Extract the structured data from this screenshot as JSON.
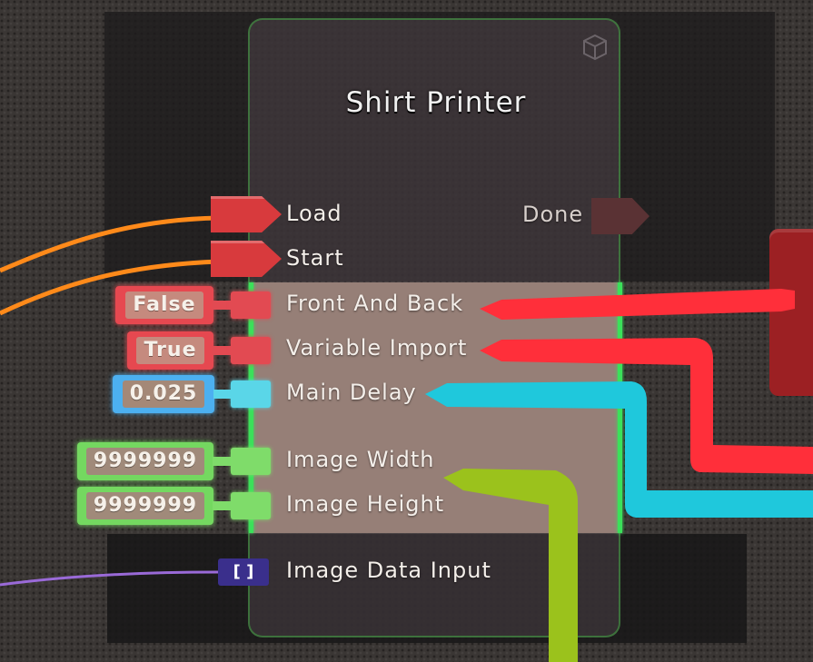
{
  "node": {
    "title": "Shirt Printer",
    "icon": "cube-icon",
    "impulse_inputs": [
      {
        "label": "Load"
      },
      {
        "label": "Start"
      }
    ],
    "impulse_outputs": [
      {
        "label": "Done"
      }
    ],
    "value_inputs": [
      {
        "label": "Front And Back",
        "value": "False",
        "type_color": "#e24a52"
      },
      {
        "label": "Variable Import",
        "value": "True",
        "type_color": "#e24a52"
      },
      {
        "label": "Main Delay",
        "value": "0.025",
        "type_color": "#5ad6e8"
      },
      {
        "label": "Image Width",
        "value": "9999999",
        "type_color": "#7fdc6a"
      },
      {
        "label": "Image Height",
        "value": "9999999",
        "type_color": "#7fdc6a"
      }
    ],
    "data_input": {
      "label": "Image Data Input",
      "pin_symbol": "[ ]"
    }
  },
  "colors": {
    "bool_wire": "#ff2f3a",
    "float_wire": "#1fc8dc",
    "int_wire": "#9bc21c",
    "impulse_wire": "#ff8a1a",
    "data_wire": "#9a6ad8",
    "node_border": "#46aa46"
  }
}
